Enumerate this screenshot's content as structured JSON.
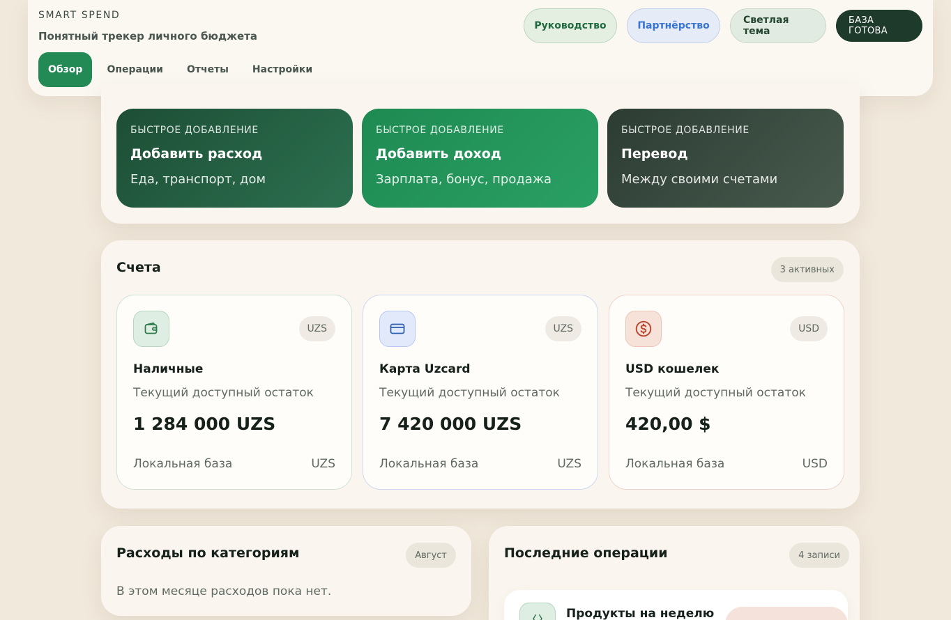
{
  "header": {
    "brand": "SMART SPEND",
    "tagline": "Понятный трекер личного бюджета",
    "nav": [
      "Обзор",
      "Операции",
      "Отчеты",
      "Настройки"
    ],
    "actions": {
      "guide": "Руководство",
      "partner": "Партнёрство",
      "theme": "Светлая тема",
      "db": "БАЗА ГОТОВА"
    }
  },
  "quick": [
    {
      "label": "БЫСТРОЕ ДОБАВЛЕНИЕ",
      "title": "Добавить расход",
      "sub": "Еда, транспорт, дом"
    },
    {
      "label": "БЫСТРОЕ ДОБАВЛЕНИЕ",
      "title": "Добавить доход",
      "sub": "Зарплата, бонус, продажа"
    },
    {
      "label": "БЫСТРОЕ ДОБАВЛЕНИЕ",
      "title": "Перевод",
      "sub": "Между своими счетами"
    }
  ],
  "accounts": {
    "title": "Счета",
    "badge": "3 активных",
    "items": [
      {
        "icon": "wallet-icon",
        "currency": "UZS",
        "name": "Наличные",
        "desc": "Текущий доступный остаток",
        "amount": "1 284 000 UZS",
        "source": "Локальная база",
        "foot_currency": "UZS",
        "color": "#2f7a4c"
      },
      {
        "icon": "card-icon",
        "currency": "UZS",
        "name": "Карта Uzcard",
        "desc": "Текущий доступный остаток",
        "amount": "7 420 000 UZS",
        "source": "Локальная база",
        "foot_currency": "UZS",
        "color": "#2f5fb0"
      },
      {
        "icon": "dollar-icon",
        "currency": "USD",
        "name": "USD кошелек",
        "desc": "Текущий доступный остаток",
        "amount": "420,00 $",
        "source": "Локальная база",
        "foot_currency": "USD",
        "color": "#b8452e"
      }
    ]
  },
  "categories": {
    "title": "Расходы по категориям",
    "badge": "Август",
    "empty": "В этом месяце расходов пока нет."
  },
  "operations": {
    "title": "Последние операции",
    "badge": "4 записи",
    "first": {
      "title": "Продукты на неделю",
      "icon": "tag-icon"
    }
  }
}
